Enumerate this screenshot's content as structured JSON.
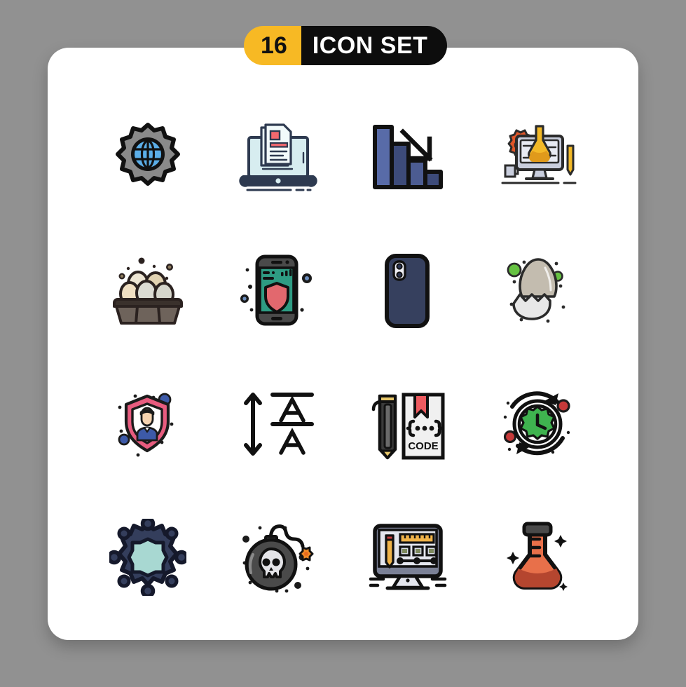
{
  "background": {
    "color": "#919191"
  },
  "card": {
    "color": "#ffffff"
  },
  "header": {
    "count": "16",
    "title": "ICON SET",
    "count_bg": "#F7B924",
    "title_bg": "#0D0D0D",
    "count_color": "#111111",
    "title_color": "#FFFFFF"
  },
  "grid": {
    "columns": 4,
    "rows": 4,
    "icons": [
      {
        "id": 1,
        "name": "global-settings-gear-globe-icon",
        "label": "",
        "row": 1,
        "col": 1,
        "colors": [
          "#8A8A8A",
          "#5BAEE8",
          "#1A1A1A"
        ]
      },
      {
        "id": 2,
        "name": "laptop-document-file-icon",
        "label": "",
        "row": 1,
        "col": 2,
        "colors": [
          "#D7EDF0",
          "#2E3A50",
          "#F3686E"
        ]
      },
      {
        "id": 3,
        "name": "decreasing-bar-chart-loss-icon",
        "label": "",
        "row": 1,
        "col": 3,
        "colors": [
          "#4C5C92",
          "#3D4B7A",
          "#111111"
        ]
      },
      {
        "id": 4,
        "name": "science-lab-monitor-flask-icon",
        "label": "",
        "row": 1,
        "col": 4,
        "colors": [
          "#C9CEDD",
          "#F3B927",
          "#E0562A"
        ]
      },
      {
        "id": 5,
        "name": "egg-carton-tray-icon",
        "label": "",
        "row": 2,
        "col": 1,
        "colors": [
          "#6E635B",
          "#EDE5D3",
          "#2B2220"
        ]
      },
      {
        "id": 6,
        "name": "mobile-security-shield-icon",
        "label": "",
        "row": 2,
        "col": 2,
        "colors": [
          "#2E9C83",
          "#E2686E",
          "#3A3A3A"
        ]
      },
      {
        "id": 7,
        "name": "smartphone-back-camera-icon",
        "label": "",
        "row": 2,
        "col": 3,
        "colors": [
          "#36405E",
          "#111111",
          "#FFFFFF"
        ]
      },
      {
        "id": 8,
        "name": "cracked-egg-shell-icon",
        "label": "",
        "row": 2,
        "col": 4,
        "colors": [
          "#C3BCAF",
          "#E8E8E8",
          "#66C242"
        ]
      },
      {
        "id": 9,
        "name": "user-shield-protection-icon",
        "label": "",
        "row": 3,
        "col": 1,
        "colors": [
          "#E85C7F",
          "#3D5AA8",
          "#F7D4B0"
        ]
      },
      {
        "id": 10,
        "name": "line-spacing-text-icon",
        "label": "",
        "row": 3,
        "col": 2,
        "colors": [
          "#111111"
        ]
      },
      {
        "id": 11,
        "name": "code-book-pencil-icon",
        "label": "CODE",
        "row": 3,
        "col": 3,
        "colors": [
          "#F0F0F0",
          "#EE5B60",
          "#3A3A3A"
        ]
      },
      {
        "id": 12,
        "name": "clock-history-refresh-icon",
        "label": "",
        "row": 3,
        "col": 4,
        "colors": [
          "#3FB34F",
          "#111111",
          "#C73A3A"
        ]
      },
      {
        "id": 13,
        "name": "ship-wheel-helm-icon",
        "label": "",
        "row": 4,
        "col": 1,
        "colors": [
          "#343E5C",
          "#A8D8D2",
          "#15192B"
        ]
      },
      {
        "id": 14,
        "name": "bomb-skull-explosive-icon",
        "label": "",
        "row": 4,
        "col": 2,
        "colors": [
          "#4A4A4A",
          "#EAEAEA",
          "#F08B28"
        ]
      },
      {
        "id": 15,
        "name": "design-monitor-tools-icon",
        "label": "",
        "row": 4,
        "col": 3,
        "colors": [
          "#E4E6EE",
          "#7B8196",
          "#F0B44A"
        ]
      },
      {
        "id": 16,
        "name": "chemistry-flask-beaker-icon",
        "label": "",
        "row": 4,
        "col": 4,
        "colors": [
          "#E8704A",
          "#B5462F",
          "#4A4A4A"
        ]
      }
    ]
  }
}
